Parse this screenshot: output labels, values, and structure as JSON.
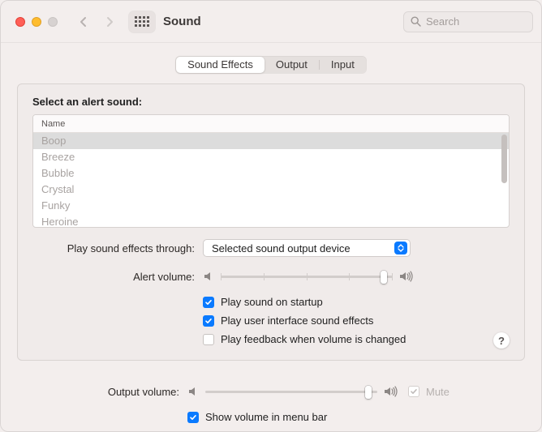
{
  "window": {
    "title": "Sound",
    "search_placeholder": "Search"
  },
  "tabs": {
    "effects": "Sound Effects",
    "output": "Output",
    "input": "Input"
  },
  "section_label": "Select an alert sound:",
  "list": {
    "header": "Name",
    "rows": [
      "Boop",
      "Breeze",
      "Bubble",
      "Crystal",
      "Funky",
      "Heroine"
    ]
  },
  "playthrough": {
    "label": "Play sound effects through:",
    "value": "Selected sound output device"
  },
  "alertvol": {
    "label": "Alert volume:",
    "position": 0.95
  },
  "checks": {
    "startup": "Play sound on startup",
    "ui": "Play user interface sound effects",
    "feedback": "Play feedback when volume is changed"
  },
  "outputvol": {
    "label": "Output volume:",
    "position": 0.95,
    "mute": "Mute"
  },
  "menubar": "Show volume in menu bar",
  "help": "?"
}
